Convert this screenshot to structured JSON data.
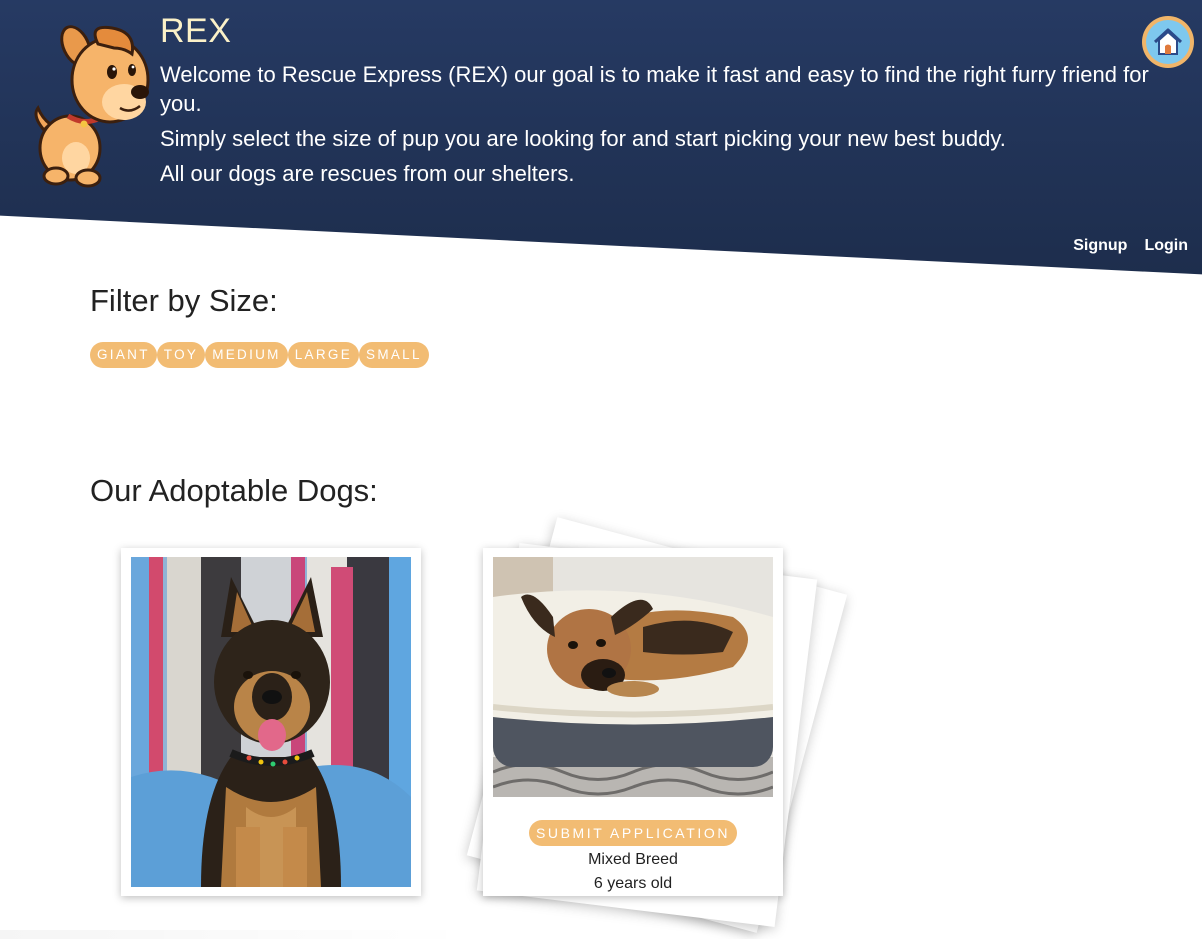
{
  "brand": {
    "title": "REX"
  },
  "intro": {
    "line1": "Welcome to Rescue Express (REX) our goal is to make it fast and easy to find the right furry friend for you.",
    "line2": "Simply select the size of pup you are looking for and start picking your new best buddy.",
    "line3": "All our dogs are rescues from our shelters."
  },
  "nav": {
    "signup": "Signup",
    "login": "Login",
    "home_icon": "home-icon"
  },
  "filter": {
    "title": "Filter by Size:",
    "sizes": [
      "GIANT",
      "TOY",
      "MEDIUM",
      "LARGE",
      "SMALL"
    ]
  },
  "dogs": {
    "title": "Our Adoptable Dogs:",
    "cards": [
      {
        "photo": "german-shepherd-photo"
      },
      {
        "photo": "mixed-breed-dog-photo",
        "button": "SUBMIT APPLICATION",
        "breed": "Mixed Breed",
        "age": "6 years old"
      }
    ]
  },
  "colors": {
    "header": "#22345a",
    "accent": "#f2bc73",
    "title_cream": "#fbf1c8"
  }
}
